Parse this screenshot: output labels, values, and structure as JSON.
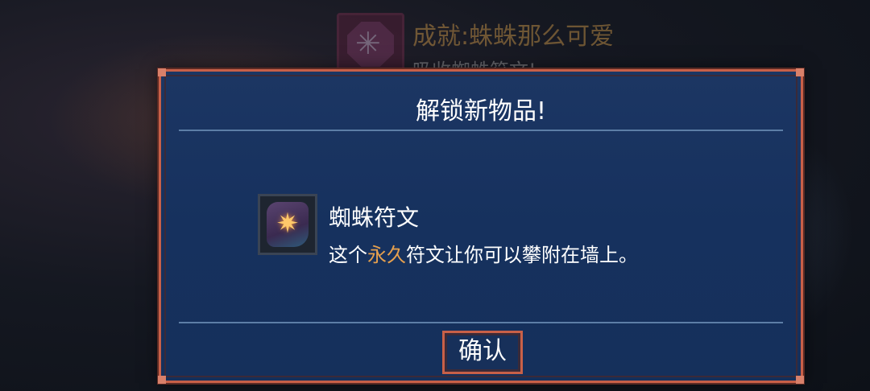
{
  "toast": {
    "title": "成就:蛛蛛那么可爱",
    "subtitle": "吸收蜘蛛符文!",
    "icon": "spider-badge-icon"
  },
  "dialog": {
    "title": "解锁新物品!",
    "item": {
      "name": "蜘蛛符文",
      "icon": "spider-rune-icon",
      "description_pre": "这个",
      "description_highlight": "永久",
      "description_post": "符文让你可以攀附在墙上。"
    },
    "confirm_label": "确认"
  },
  "colors": {
    "highlight": "#e6a04e",
    "border": "#c86048",
    "panel": "#1c3663"
  }
}
